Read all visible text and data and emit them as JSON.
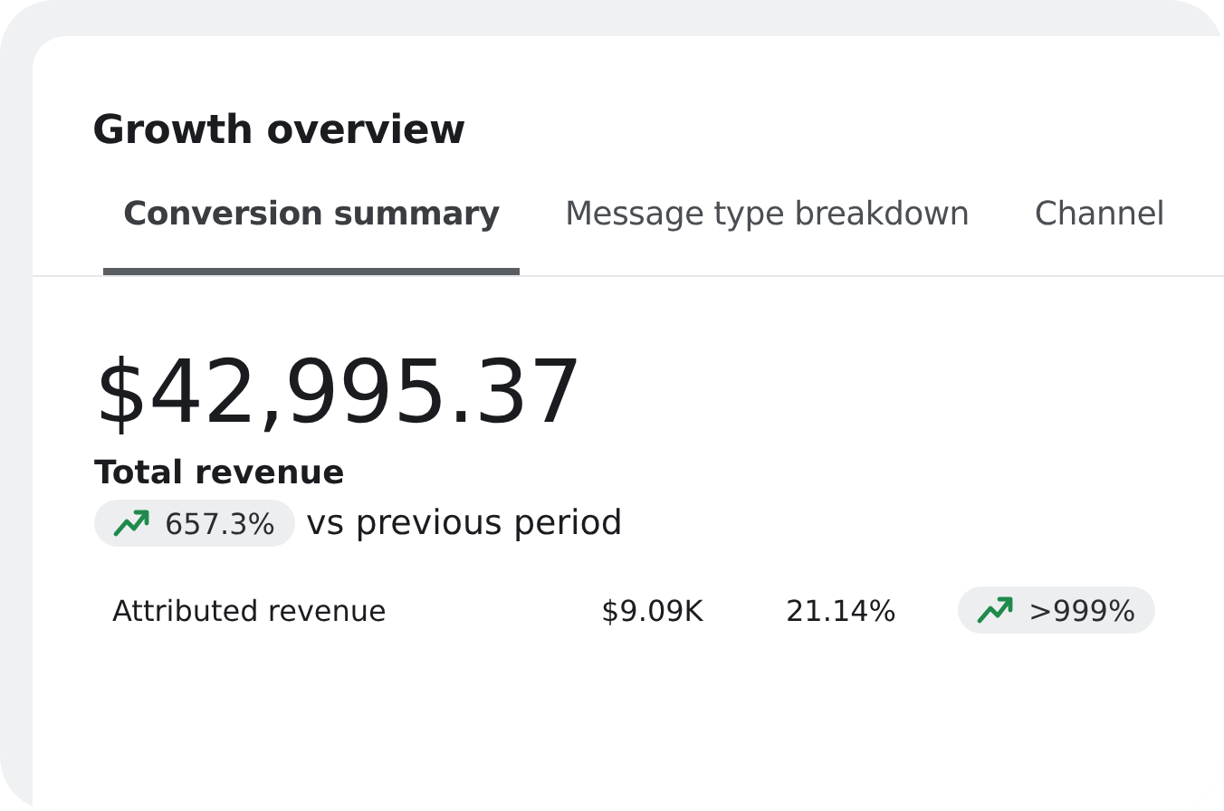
{
  "title": "Growth overview",
  "tabs": [
    {
      "label": "Conversion summary",
      "selected": true
    },
    {
      "label": "Message type breakdown",
      "selected": false
    },
    {
      "label": "Channel",
      "selected": false
    }
  ],
  "total": {
    "value": "$42,995.37",
    "label": "Total revenue",
    "change": {
      "kind": "increase",
      "text": "657.3%"
    },
    "comparison": "vs previous period"
  },
  "rows": [
    {
      "name": "Attributed revenue",
      "amount": "$9.09K",
      "share": "21.14%",
      "change": {
        "kind": "increase",
        "text": ">999%"
      }
    }
  ]
}
